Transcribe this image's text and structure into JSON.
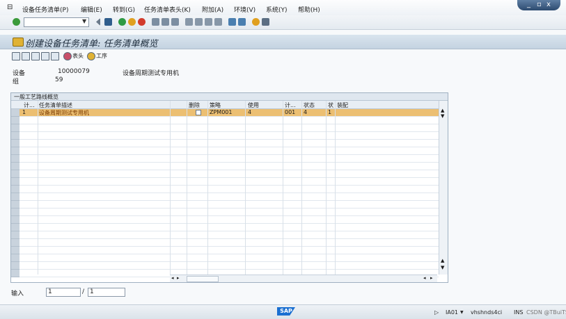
{
  "menu": {
    "items": [
      "设备任务清单(P)",
      "编辑(E)",
      "转到(G)",
      "任务清单表头(K)",
      "附加(A)",
      "环境(V)",
      "系统(Y)",
      "帮助(H)"
    ]
  },
  "window_controls": {
    "minimize": "_",
    "restore": "▫",
    "close": "x"
  },
  "screen": {
    "title": "创建设备任务清单: 任务清单概览"
  },
  "app_toolbar": {
    "header_label": "表头",
    "operations_label": "工序"
  },
  "header_fields": {
    "equipment_label": "设备",
    "equipment_value": "10000079",
    "equipment_desc": "设备周期测试专用机",
    "group_label": "组",
    "group_value": "59"
  },
  "table": {
    "caption": "一般工艺路线概览",
    "columns": [
      "计...",
      "任务清单描述",
      "",
      "删除",
      "策略",
      "使用",
      "计...",
      "状态",
      "状",
      "装配"
    ],
    "rows": [
      {
        "counter": "1",
        "description": "设备周期测试专用机",
        "delete": "",
        "strategy": "ZPM001",
        "usage": "4",
        "planner": "001",
        "status": "4",
        "st": "1",
        "assembly": ""
      }
    ]
  },
  "entry": {
    "label": "输入",
    "current": "1",
    "total": "1",
    "separator": "/"
  },
  "status_bar": {
    "logo": "SAP",
    "system": "IA01",
    "server": "vhshnds4ci",
    "mode": "INS",
    "watermark": "CSDN @TBuiTS"
  }
}
